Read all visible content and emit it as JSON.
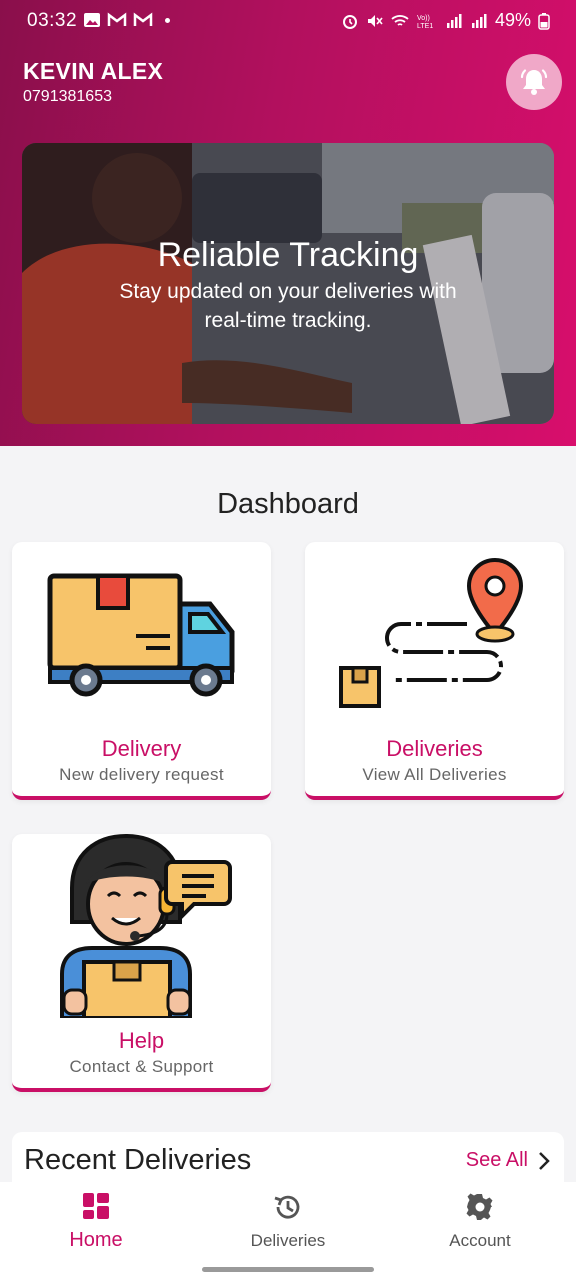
{
  "status_bar": {
    "time": "03:32",
    "battery": "49%"
  },
  "user": {
    "name": "KEVIN ALEX",
    "phone": "0791381653"
  },
  "hero": {
    "title": "Reliable Tracking",
    "subtitle": "Stay updated on your deliveries with real-time tracking."
  },
  "dashboard": {
    "title": "Dashboard",
    "cards": [
      {
        "label": "Delivery",
        "sub": "New delivery request",
        "icon": "delivery-truck-icon"
      },
      {
        "label": "Deliveries",
        "sub": "View All Deliveries",
        "icon": "route-map-icon"
      },
      {
        "label": "Help",
        "sub": "Contact & Support",
        "icon": "support-agent-icon"
      }
    ]
  },
  "recent": {
    "title": "Recent Deliveries",
    "see_all": "See All"
  },
  "bottom_nav": [
    {
      "label": "Home",
      "icon": "home-grid-icon",
      "active": true
    },
    {
      "label": "Deliveries",
      "icon": "history-icon",
      "active": false
    },
    {
      "label": "Account",
      "icon": "gear-icon",
      "active": false
    }
  ],
  "colors": {
    "accent": "#c90f66",
    "header_start": "#8a0f4b",
    "header_end": "#d80e6c"
  }
}
